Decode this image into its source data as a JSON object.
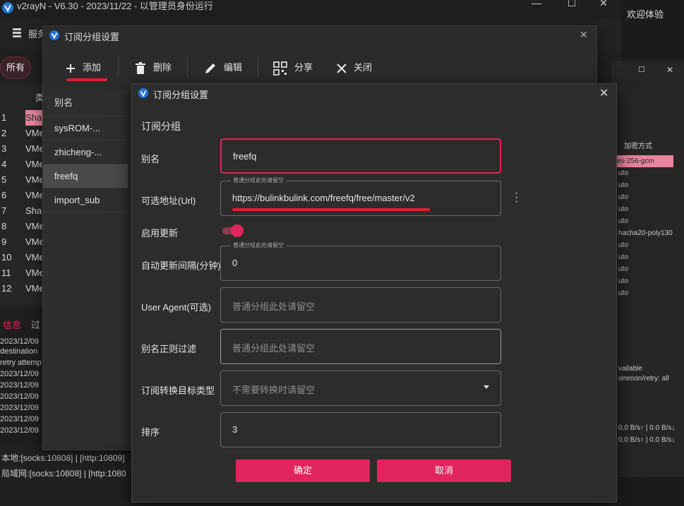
{
  "main": {
    "title": "v2rayN - V6.30 - 2023/11/22 - 以管理员身份运行",
    "menu_label": "服务",
    "filter_all": "所有",
    "column_type": "类",
    "rows": [
      {
        "num": "1",
        "type": "Sha"
      },
      {
        "num": "2",
        "type": "VMe"
      },
      {
        "num": "3",
        "type": "VMe"
      },
      {
        "num": "4",
        "type": "VMe"
      },
      {
        "num": "5",
        "type": "VMe"
      },
      {
        "num": "6",
        "type": "VMe"
      },
      {
        "num": "7",
        "type": "Sha"
      },
      {
        "num": "8",
        "type": "VMe"
      },
      {
        "num": "9",
        "type": "VMe"
      },
      {
        "num": "10",
        "type": "VMe"
      },
      {
        "num": "11",
        "type": "VMe"
      },
      {
        "num": "12",
        "type": "VMe"
      }
    ],
    "log_tabs": {
      "info": "信息",
      "filter": "过"
    },
    "log_lines": [
      "2023/12/09",
      "destination",
      "retry attemp",
      "2023/12/09",
      "2023/12/09",
      "2023/12/09",
      "2023/12/09",
      "2023/12/09",
      "2023/12/09"
    ],
    "status_local": "本地:[socks:10808] | [http:10809]",
    "status_lan": "局域网:[socks:10808] | [http:1080"
  },
  "side": {
    "header": "欢迎体验",
    "column_encryption": "加密方式",
    "rows": [
      "es-256-gcm",
      "uto",
      "uto",
      "uto",
      "uto",
      "uto",
      "hacha20-poly130",
      "uto",
      "uto",
      "uto",
      "uto",
      "uto"
    ],
    "info_lines": [
      "vailable",
      "ommon/retry: all"
    ],
    "speed_lines": [
      "0.0 B/s↑ | 0.0 B/s↓",
      "0.0 B/s↑ | 0.0 B/s↓"
    ]
  },
  "dialog1": {
    "title": "订阅分组设置",
    "toolbar": {
      "add": "添加",
      "delete": "删除",
      "edit": "编辑",
      "share": "分享",
      "close": "关闭"
    },
    "list_header": "别名",
    "items": [
      "sysROM-...",
      "zhicheng-...",
      "freefq",
      "import_sub"
    ]
  },
  "dialog2": {
    "title": "订阅分组设置",
    "section": "订阅分组",
    "fields": {
      "alias": {
        "label": "别名",
        "value": "freefq"
      },
      "url": {
        "label": "可选地址(Url)",
        "legend": "普通分组此处请留空",
        "value": "https://bulinkbulink.com/freefq/free/master/v2"
      },
      "enable_update": {
        "label": "启用更新",
        "enabled": true
      },
      "interval": {
        "label": "自动更新间隔(分钟)",
        "legend": "普通分组此处请留空",
        "value": "0"
      },
      "user_agent": {
        "label": "User Agent(可选)",
        "placeholder": "普通分组此处请留空"
      },
      "regex": {
        "label": "别名正则过滤",
        "placeholder": "普通分组此处请留空"
      },
      "convert": {
        "label": "订阅转换目标类型",
        "placeholder": "不需要转换时请留空"
      },
      "sort": {
        "label": "排序",
        "value": "3"
      }
    },
    "confirm": "确定",
    "cancel": "取消"
  },
  "colors": {
    "accent": "#e0245e",
    "underline": "#e01f2f",
    "background": "#1b1b1b",
    "dialog": "#2c2c2c"
  }
}
